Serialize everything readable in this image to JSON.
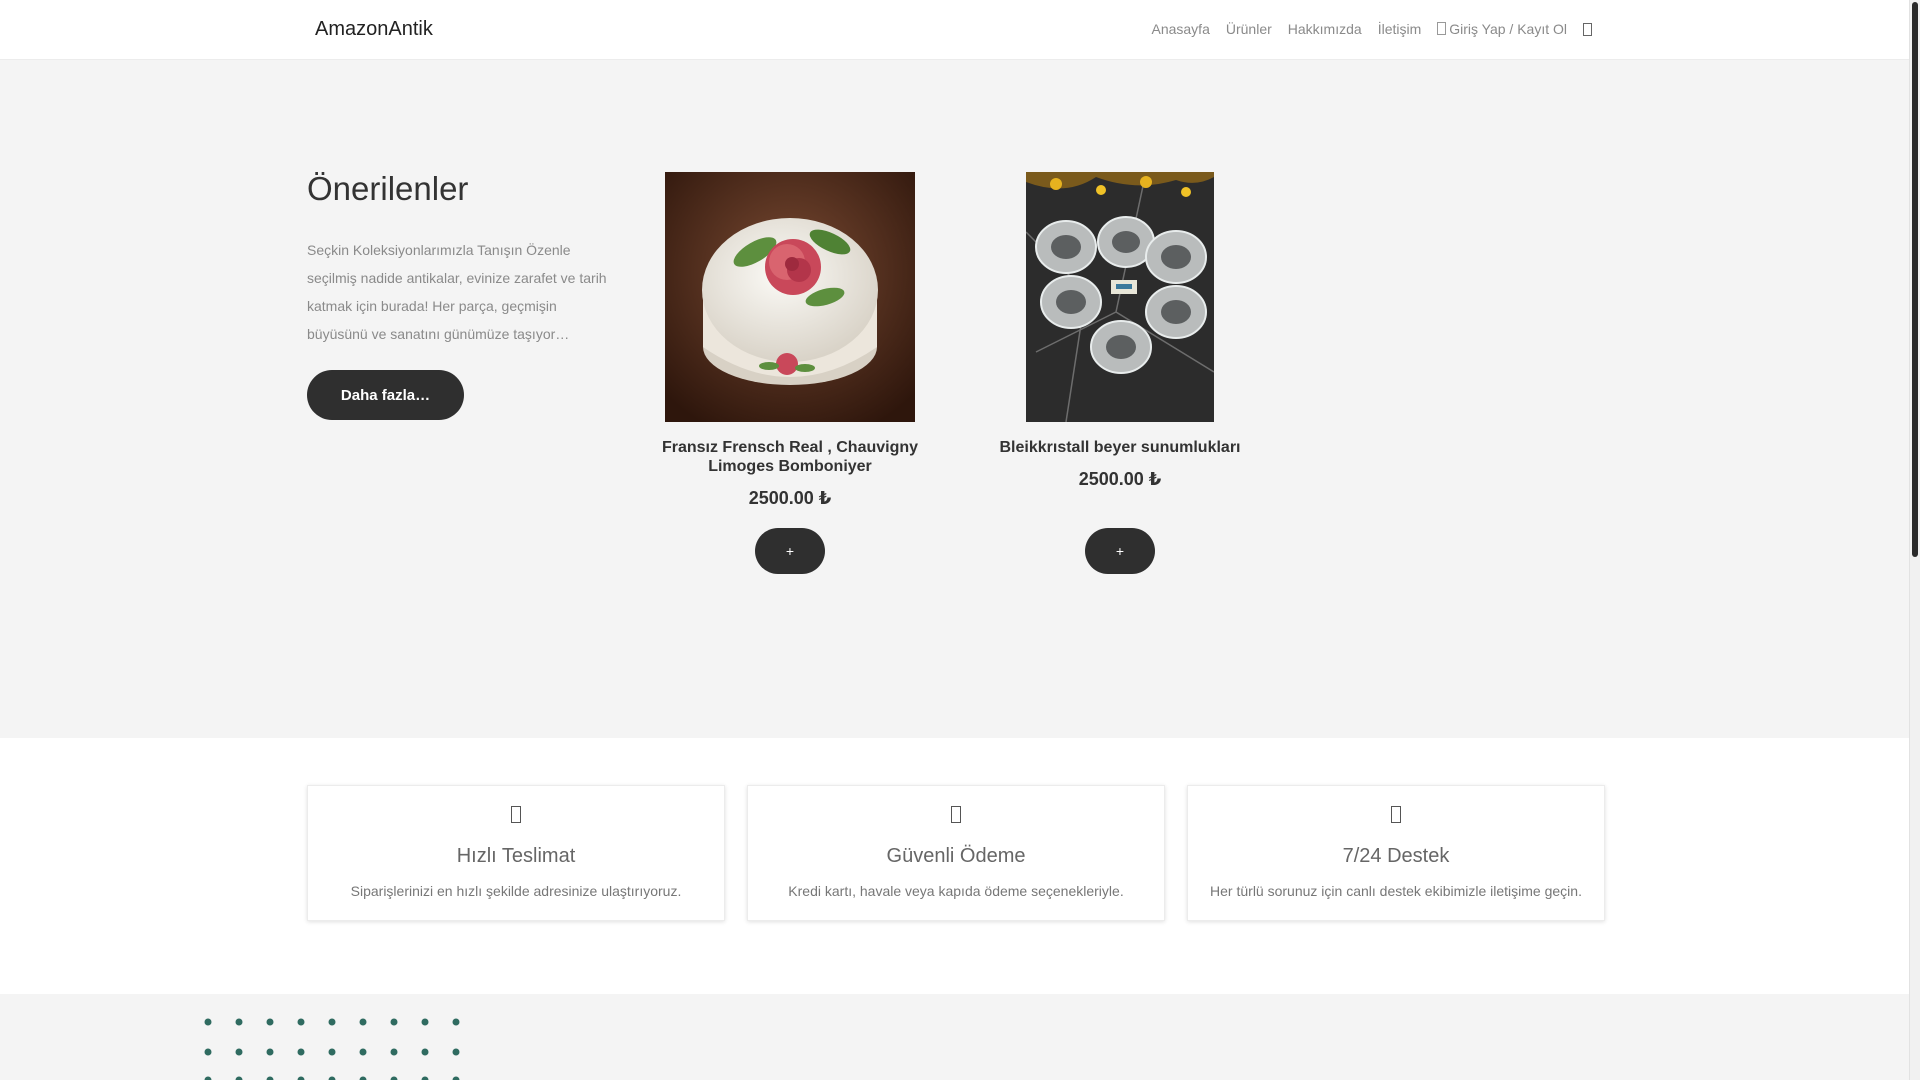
{
  "colors": {
    "accent_dark": "#2f2f2f",
    "page_bg": "#f4f4f4",
    "dot_color": "#2f6b60"
  },
  "navbar": {
    "brand": "AmazonAntik",
    "links": [
      "Anasayfa",
      "Ürünler",
      "Hakkımızda",
      "İletişim"
    ],
    "login": "Giriş Yap / Kayıt Ol",
    "cart_icon": "cart-icon"
  },
  "hero": {
    "title": "Önerilenler",
    "text": "Seçkin Koleksiyonlarımızla Tanışın Özenle seçilmiş nadide antikalar, evinize zarafet ve tarih katmak için burada! Her parça, geçmişin büyüsünü ve sanatını günümüze taşıyor…",
    "button": "Daha fazla…"
  },
  "products": [
    {
      "name": "Fransız Frensch Real , Chauvigny Limoges Bomboniyer",
      "price": "2500.00 ₺",
      "add_label": "+"
    },
    {
      "name": "Bleikkrıstall beyer sunumlukları",
      "price": "2500.00 ₺",
      "add_label": "+"
    }
  ],
  "features": [
    {
      "icon": "truck-icon",
      "title": "Hızlı Teslimat",
      "text": "Siparişlerinizi en hızlı şekilde adresinize ulaştırıyoruz."
    },
    {
      "icon": "lock-icon",
      "title": "Güvenli Ödeme",
      "text": "Kredi kartı, havale veya kapıda ödeme seçenekleriyle."
    },
    {
      "icon": "headset-icon",
      "title": "7/24 Destek",
      "text": "Her türlü sorunuz için canlı destek ekibimizle iletişime geçin."
    }
  ]
}
